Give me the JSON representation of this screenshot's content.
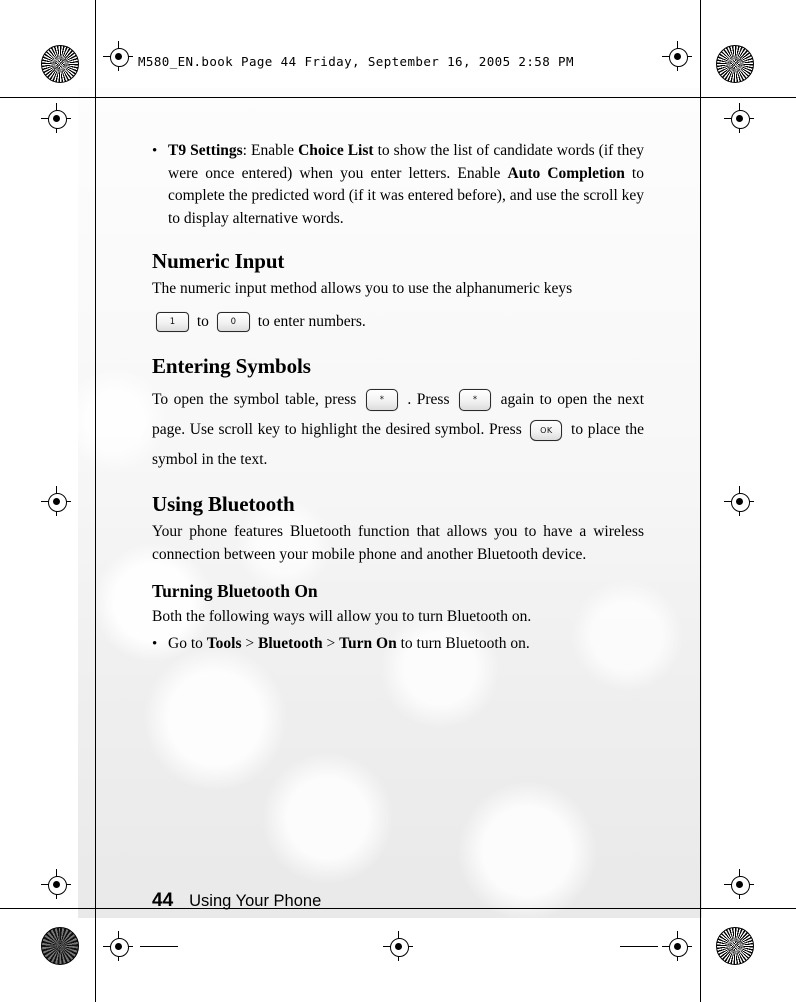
{
  "header": {
    "text": "M580_EN.book  Page 44  Friday, September 16, 2005  2:58 PM"
  },
  "content": {
    "bullet_t9": {
      "marker": "•",
      "label": "T9 Settings",
      "part1": ": Enable ",
      "bold1": "Choice List",
      "part2": " to show the list of candidate words (if they were once entered) when you enter letters. Enable ",
      "bold2": "Auto Completion",
      "part3": " to complete the predicted word (if it was entered before), and use the scroll key to display alternative words."
    },
    "numeric_heading": "Numeric Input",
    "numeric_text_1": "The numeric input method allows you to use the alphanumeric keys",
    "numeric_key_1": "1",
    "numeric_between": "to",
    "numeric_key_0": "0",
    "numeric_text_2": "to enter numbers.",
    "symbols_heading": "Entering Symbols",
    "symbols_text_1": "To open the symbol table, press",
    "symbols_key_star_1": "*",
    "symbols_text_2": ". Press",
    "symbols_key_star_2": "*",
    "symbols_text_3": "again to open the next page. Use scroll key to highlight the desired symbol. Press",
    "symbols_key_ok": "OK",
    "symbols_text_4": "to place the symbol in the text.",
    "bluetooth_heading": "Using Bluetooth",
    "bluetooth_text": "Your phone features Bluetooth function that allows you to have a wireless connection between your mobile phone and another Bluetooth device.",
    "turning_heading": "Turning Bluetooth On",
    "turning_text": "Both the following ways will allow you to turn Bluetooth on.",
    "bullet_goto": {
      "marker": "•",
      "pre": "Go to ",
      "b1": "Tools",
      "sep1": " > ",
      "b2": "Bluetooth",
      "sep2": " > ",
      "b3": "Turn On",
      "post": " to turn Bluetooth on."
    }
  },
  "footer": {
    "page_number": "44",
    "section": "Using Your Phone"
  }
}
